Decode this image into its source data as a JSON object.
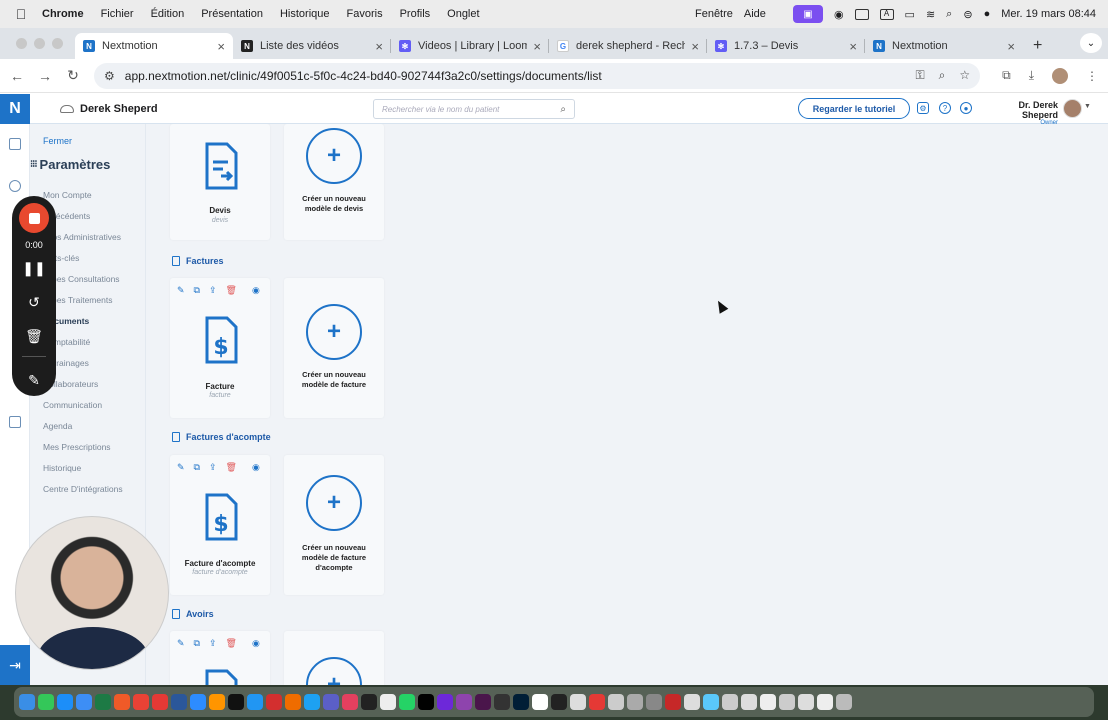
{
  "menubar": {
    "apple": "",
    "app_name": "Chrome",
    "menus": [
      "Fichier",
      "Édition",
      "Présentation",
      "Historique",
      "Favoris",
      "Profils",
      "Onglet"
    ],
    "right_menus": [
      "Fenêtre",
      "Aide"
    ],
    "clock": "Mer. 19 mars  08:44"
  },
  "browser": {
    "tabs": [
      {
        "title": "Nextmotion",
        "icon": "nextmotion-icon",
        "color": "#1e73c8",
        "active": true
      },
      {
        "title": "Liste des vidéos",
        "icon": "notion-icon",
        "color": "#222222",
        "active": false
      },
      {
        "title": "Videos | Library | Loom",
        "icon": "loom-icon",
        "color": "#625df5",
        "active": false
      },
      {
        "title": "derek shepherd - Recherche",
        "icon": "google-icon",
        "color": "#4285f4",
        "active": false
      },
      {
        "title": "1.7.3 – Devis",
        "icon": "loom-icon",
        "color": "#625df5",
        "active": false
      },
      {
        "title": "Nextmotion",
        "icon": "nextmotion-icon",
        "color": "#1e73c8",
        "active": false
      }
    ],
    "url": "app.nextmotion.net/clinic/49f0051c-5f0c-4c24-bd40-902744f3a2c0/settings/documents/list"
  },
  "app": {
    "logo": "N",
    "clinic_name": "Derek Sheperd",
    "search_placeholder": "Rechercher via le nom du patient",
    "tutorial_button": "Regarder le tutoriel",
    "user_name": "Dr. Derek Sheperd",
    "user_role": "Owner",
    "colors": {
      "accent": "#1e73c8",
      "danger": "#e05a5a",
      "background": "#f0f3f7"
    }
  },
  "settings_menu": {
    "close": "Fermer",
    "title": "Paramètres",
    "items": [
      {
        "label": "Mon Compte",
        "active": false
      },
      {
        "label": "Antécédents",
        "active": false
      },
      {
        "label": "Infos Administratives",
        "active": false
      },
      {
        "label": "Mots-clés",
        "active": false
      },
      {
        "label": "Types Consultations",
        "active": false
      },
      {
        "label": "Types Traitements",
        "active": false
      },
      {
        "label": "Documents",
        "active": true
      },
      {
        "label": "Comptabilité",
        "active": false
      },
      {
        "label": "Parrainages",
        "active": false
      },
      {
        "label": "Collaborateurs",
        "active": false
      },
      {
        "label": "Communication",
        "active": false
      },
      {
        "label": "Agenda",
        "active": false
      },
      {
        "label": "Mes Prescriptions",
        "active": false
      },
      {
        "label": "Historique",
        "active": false
      },
      {
        "label": "Centre D'intégrations",
        "active": false
      }
    ]
  },
  "documents": {
    "devis": {
      "name": "Devis",
      "sub": "devis",
      "new_label": "Créer un nouveau modèle de devis"
    },
    "factures": {
      "section": "Factures",
      "name": "Facture",
      "sub": "facture",
      "new_label": "Créer un nouveau modèle de facture"
    },
    "acompte": {
      "section": "Factures d'acompte",
      "name": "Facture d'acompte",
      "sub": "facture d'acompte",
      "new_label": "Créer un nouveau modèle de facture d'acompte"
    },
    "avoirs": {
      "section": "Avoirs"
    }
  },
  "loom": {
    "timer": "0:00"
  }
}
